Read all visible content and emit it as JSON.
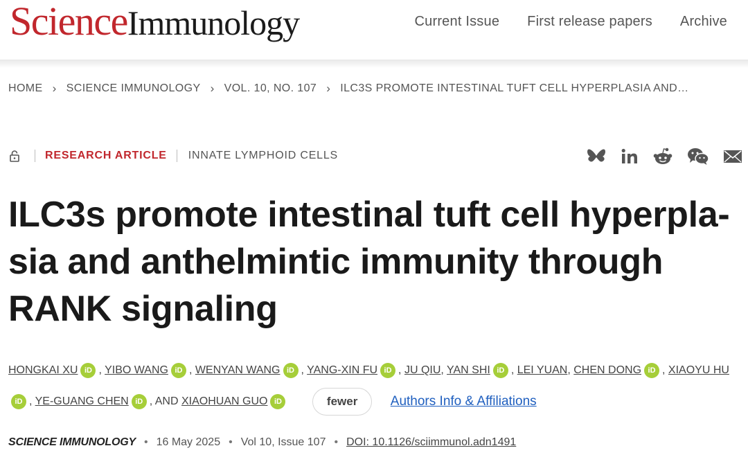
{
  "brand": {
    "science": "Science",
    "journal": "Immunology"
  },
  "nav": [
    {
      "label": "Current Issue"
    },
    {
      "label": "First release papers"
    },
    {
      "label": "Archive"
    }
  ],
  "breadcrumb": [
    {
      "label": "HOME"
    },
    {
      "label": "SCIENCE IMMUNOLOGY"
    },
    {
      "label": "VOL. 10, NO. 107"
    },
    {
      "label": "ILC3S PROMOTE INTESTINAL TUFT CELL HYPERPLASIA AND…"
    }
  ],
  "meta": {
    "article_type": "RESEARCH ARTICLE",
    "subject": "INNATE LYMPHOID CELLS"
  },
  "share": {
    "icons": [
      "bluesky-icon",
      "linkedin-icon",
      "reddit-icon",
      "wechat-icon",
      "email-icon"
    ],
    "icon_color": "#555555"
  },
  "title": "ILC3s promote intestinal tuft cell hyperpla-sia and anthelmintic immunity through RANK signaling",
  "title_lines": [
    "ILC3s promote intestinal tuft cell hyperpla-",
    "sia and anthelmintic immunity through",
    "RANK signaling"
  ],
  "authors": {
    "names": [
      "HONGKAI XU",
      "YIBO WANG",
      "WENYAN WANG",
      "YANG-XIN FU",
      "JU QIU",
      "YAN SHI",
      "LEI YUAN",
      "CHEN DONG",
      "XIAOYU HU",
      "YE-GUANG CHEN",
      "XIAOHUAN GUO"
    ],
    "orcid_label": "iD",
    "and_label": "AND",
    "fewer_label": "fewer",
    "affiliations_label": "Authors Info & Affiliations",
    "orcid_color": "#a6ce39"
  },
  "publication": {
    "journal": "SCIENCE IMMUNOLOGY",
    "date": "16 May 2025",
    "issue": "Vol 10, Issue 107",
    "doi": "DOI: 10.1126/sciimmunol.adn1491"
  },
  "colors": {
    "brand_red": "#c1272d",
    "link_blue": "#1f5fbf"
  }
}
